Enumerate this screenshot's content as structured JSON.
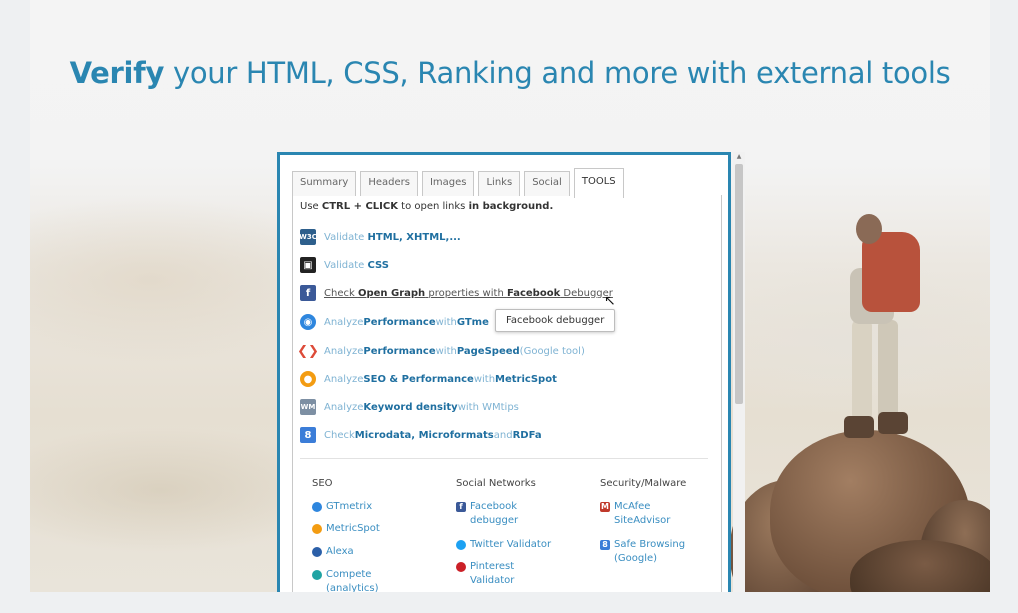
{
  "headline": {
    "bold": "Verify",
    "rest": " your HTML, CSS, Ranking and more with external tools"
  },
  "tabs": [
    "Summary",
    "Headers",
    "Images",
    "Links",
    "Social",
    "TOOLS"
  ],
  "note": {
    "pre": "Use ",
    "keys": "CTRL + CLICK",
    "mid": " to open links ",
    "post": "in background."
  },
  "tools": [
    {
      "icon": "w3c-icon",
      "text": "Validate ",
      "bold": "HTML, XHTML,...",
      "tail": ""
    },
    {
      "icon": "css-validator-icon",
      "text": "Validate ",
      "bold": "CSS",
      "tail": ""
    },
    {
      "icon": "facebook-icon",
      "text": "Check ",
      "bold": "Open Graph",
      "mid": " properties with ",
      "bold2": "Facebook",
      "tail": " Debugger"
    },
    {
      "icon": "gtmetrix-icon",
      "text": "Analyze ",
      "bold": "Performance",
      "mid": " with ",
      "bold2": "GTme",
      "tail": ""
    },
    {
      "icon": "pagespeed-icon",
      "text": "Analyze ",
      "bold": "Performance",
      "mid": " with ",
      "bold2": "PageSpeed",
      "tail": " (Google tool)"
    },
    {
      "icon": "metricspot-icon",
      "text": "Analyze ",
      "bold": "SEO & Performance",
      "mid": " with ",
      "bold2": "MetricSpot",
      "tail": ""
    },
    {
      "icon": "wmtips-icon",
      "text": "Analyze ",
      "bold": "Keyword density",
      "mid": " with WMtips",
      "bold2": "",
      "tail": ""
    },
    {
      "icon": "google-plus-icon",
      "text": "Check ",
      "bold": "Microdata, Microformats",
      "mid": " and ",
      "bold2": "RDFa",
      "tail": ""
    }
  ],
  "tooltip": "Facebook debugger",
  "columns": {
    "seo": {
      "heading": "SEO",
      "links": [
        "GTmetrix",
        "MetricSpot",
        "Alexa",
        "Compete (analytics)"
      ]
    },
    "social": {
      "heading": "Social Networks",
      "links": [
        "Facebook debugger",
        "Twitter Validator",
        "Pinterest Validator"
      ]
    },
    "security": {
      "heading": "Security/Malware",
      "links": [
        "McAfee SiteAdvisor",
        "Safe Browsing (Google)"
      ]
    }
  },
  "colors": {
    "accent": "#2a86b1",
    "link": "#3a8ec1"
  }
}
